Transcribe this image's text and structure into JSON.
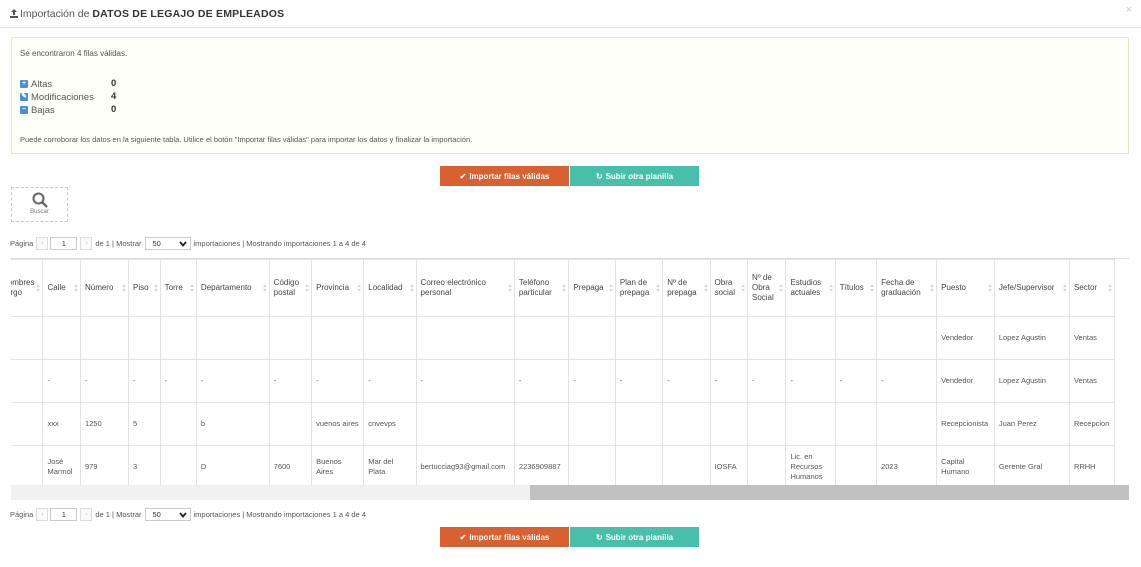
{
  "header": {
    "title_prefix": "Importación de",
    "title_bold": "DATOS DE LEGAJO DE EMPLEADOS",
    "close": "×"
  },
  "summary": {
    "found_prefix": "Se encontraron",
    "found_count": "4",
    "found_suffix": "filas válidas.",
    "rows": [
      {
        "label": "Altas",
        "value": "0",
        "icon": "plus-square-icon",
        "glyph": "+"
      },
      {
        "label": "Modificaciones",
        "value": "4",
        "icon": "edit-square-icon",
        "glyph": "✎"
      },
      {
        "label": "Bajas",
        "value": "0",
        "icon": "minus-square-icon",
        "glyph": "−"
      }
    ],
    "hint": "Puede corroborar los datos en la siguiente tabla. Utilice el botón \"Importar filas válidas\" para importar los datos y finalizar la importación."
  },
  "buttons": {
    "import_label": "Importar filas válidas",
    "upload_label": "Subir otra planilla",
    "import_color": "#d96030",
    "upload_color": "#47bfab"
  },
  "search": {
    "label": "Buscar"
  },
  "pager": {
    "page_label": "Página",
    "page_value": "1",
    "of_label": "de 1 | Mostrar",
    "per_page": "50",
    "info": "importaciones | Mostrando importaciones 1 a 4 de 4"
  },
  "table": {
    "columns": [
      "Nombres\ncargo",
      "Calle",
      "Número",
      "Piso",
      "Torre",
      "Departamento",
      "Código postal",
      "Provincia",
      "Localidad",
      "Correo electrónico personal",
      "Teléfono particular",
      "Prepaga",
      "Plan de prepaga",
      "Nº de prepaga",
      "Obra social",
      "Nº de Obra Social",
      "Estudios actuales",
      "Títulos",
      "Fecha de graduación",
      "Puesto",
      "Jefe/Supervisor",
      "Sector"
    ],
    "rows": [
      [
        "",
        "",
        "",
        "",
        "",
        "",
        "",
        "",
        "",
        "",
        "",
        "",
        "",
        "",
        "",
        "",
        "",
        "",
        "",
        "Vendedor",
        "Lopez Agustin",
        "Ventas"
      ],
      [
        "",
        "-",
        "-",
        "-",
        "-",
        "-",
        "-",
        "-",
        "-",
        "-",
        "-",
        "-",
        "-",
        "-",
        "-",
        "-",
        "-",
        "-",
        "-",
        "Vendedor",
        "Lopez Agustin",
        "Ventas"
      ],
      [
        "",
        "xxx",
        "1250",
        "5",
        "",
        "b",
        "",
        "vuenos aires",
        "cnvevps",
        "",
        "",
        "",
        "",
        "",
        "",
        "",
        "",
        "",
        "",
        "Recepcionista",
        "Juan Perez",
        "Recepcion"
      ],
      [
        "",
        "José Marmol",
        "979",
        "3",
        "",
        "D",
        "7600",
        "Buenos Aires",
        "Mar del Plata",
        "bertucciag93@gmail.com",
        "2236909887",
        "",
        "",
        "",
        "IOSFA",
        "",
        "Lic. en Recursos Humanos",
        "",
        "2023",
        "Capital Humano",
        "Gerente Gral",
        "RRHH"
      ]
    ]
  }
}
